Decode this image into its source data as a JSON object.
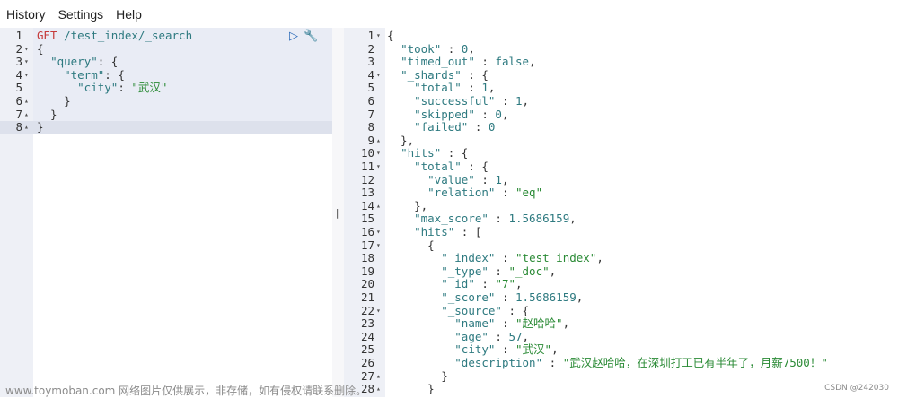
{
  "menu": [
    "History",
    "Settings",
    "Help"
  ],
  "request": {
    "method": "GET",
    "path": "/test_index/_search",
    "lines": [
      {
        "n": "1",
        "fold": "",
        "html": "<span class=\"kw\">GET</span> <span class=\"url\">/test_index/_search</span>"
      },
      {
        "n": "2",
        "fold": "▾",
        "html": "{"
      },
      {
        "n": "3",
        "fold": "▾",
        "html": "  <span class=\"k\">\"query\"</span>: {"
      },
      {
        "n": "4",
        "fold": "▾",
        "html": "    <span class=\"k\">\"term\"</span>: {"
      },
      {
        "n": "5",
        "fold": "",
        "html": "      <span class=\"k\">\"city\"</span>: <span class=\"s\">\"武汉\"</span>"
      },
      {
        "n": "6",
        "fold": "▴",
        "html": "    }"
      },
      {
        "n": "7",
        "fold": "▴",
        "html": "  }"
      },
      {
        "n": "8",
        "fold": "▴",
        "html": "}"
      }
    ]
  },
  "response": {
    "lines": [
      {
        "n": "1",
        "fold": "▾",
        "html": "{"
      },
      {
        "n": "2",
        "fold": "",
        "html": "  <span class=\"k\">\"took\"</span> : <span class=\"n\">0</span>,"
      },
      {
        "n": "3",
        "fold": "",
        "html": "  <span class=\"k\">\"timed_out\"</span> : <span class=\"n\">false</span>,"
      },
      {
        "n": "4",
        "fold": "▾",
        "html": "  <span class=\"k\">\"_shards\"</span> : {"
      },
      {
        "n": "5",
        "fold": "",
        "html": "    <span class=\"k\">\"total\"</span> : <span class=\"n\">1</span>,"
      },
      {
        "n": "6",
        "fold": "",
        "html": "    <span class=\"k\">\"successful\"</span> : <span class=\"n\">1</span>,"
      },
      {
        "n": "7",
        "fold": "",
        "html": "    <span class=\"k\">\"skipped\"</span> : <span class=\"n\">0</span>,"
      },
      {
        "n": "8",
        "fold": "",
        "html": "    <span class=\"k\">\"failed\"</span> : <span class=\"n\">0</span>"
      },
      {
        "n": "9",
        "fold": "▴",
        "html": "  },"
      },
      {
        "n": "10",
        "fold": "▾",
        "html": "  <span class=\"k\">\"hits\"</span> : {"
      },
      {
        "n": "11",
        "fold": "▾",
        "html": "    <span class=\"k\">\"total\"</span> : {"
      },
      {
        "n": "12",
        "fold": "",
        "html": "      <span class=\"k\">\"value\"</span> : <span class=\"n\">1</span>,"
      },
      {
        "n": "13",
        "fold": "",
        "html": "      <span class=\"k\">\"relation\"</span> : <span class=\"s\">\"eq\"</span>"
      },
      {
        "n": "14",
        "fold": "▴",
        "html": "    },"
      },
      {
        "n": "15",
        "fold": "",
        "html": "    <span class=\"k\">\"max_score\"</span> : <span class=\"n\">1.5686159</span>,"
      },
      {
        "n": "16",
        "fold": "▾",
        "html": "    <span class=\"k\">\"hits\"</span> : ["
      },
      {
        "n": "17",
        "fold": "▾",
        "html": "      {"
      },
      {
        "n": "18",
        "fold": "",
        "html": "        <span class=\"k\">\"_index\"</span> : <span class=\"s\">\"test_index\"</span>,"
      },
      {
        "n": "19",
        "fold": "",
        "html": "        <span class=\"k\">\"_type\"</span> : <span class=\"s\">\"_doc\"</span>,"
      },
      {
        "n": "20",
        "fold": "",
        "html": "        <span class=\"k\">\"_id\"</span> : <span class=\"s\">\"7\"</span>,"
      },
      {
        "n": "21",
        "fold": "",
        "html": "        <span class=\"k\">\"_score\"</span> : <span class=\"n\">1.5686159</span>,"
      },
      {
        "n": "22",
        "fold": "▾",
        "html": "        <span class=\"k\">\"_source\"</span> : {"
      },
      {
        "n": "23",
        "fold": "",
        "html": "          <span class=\"k\">\"name\"</span> : <span class=\"s\">\"赵哈哈\"</span>,"
      },
      {
        "n": "24",
        "fold": "",
        "html": "          <span class=\"k\">\"age\"</span> : <span class=\"n\">57</span>,"
      },
      {
        "n": "25",
        "fold": "",
        "html": "          <span class=\"k\">\"city\"</span> : <span class=\"s\">\"武汉\"</span>,"
      },
      {
        "n": "26",
        "fold": "",
        "html": "          <span class=\"k\">\"description\"</span> : <span class=\"s\">\"武汉赵哈哈，在深圳打工已有半年了，月薪7500！\"</span>"
      },
      {
        "n": "27",
        "fold": "▴",
        "html": "        }"
      },
      {
        "n": "28",
        "fold": "▴",
        "html": "      }"
      }
    ]
  },
  "watermark": "www.toymoban.com 网络图片仅供展示，非存储，如有侵权请联系删除。",
  "credit": "CSDN @242030",
  "icons": {
    "run": "play-icon",
    "settings": "wrench-icon",
    "splitter": "drag-handle-icon"
  }
}
